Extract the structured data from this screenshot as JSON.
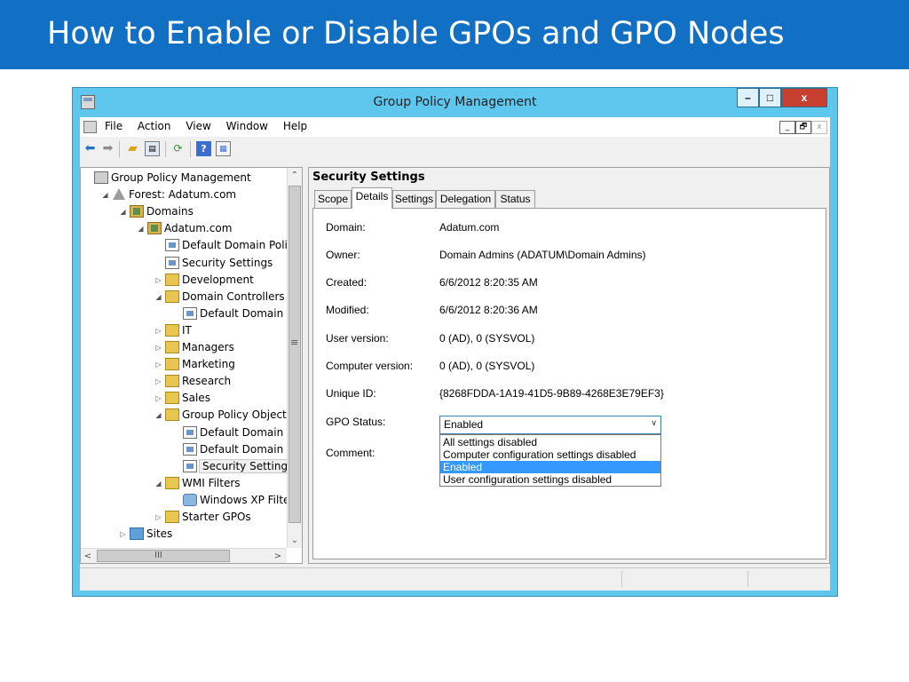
{
  "slide": {
    "title": "How to Enable or Disable GPOs and GPO Nodes"
  },
  "window": {
    "title": "Group Policy Management",
    "controls": {
      "minimize": "–",
      "maximize": "□",
      "close": "x"
    }
  },
  "menu": {
    "items": [
      "File",
      "Action",
      "View",
      "Window",
      "Help"
    ],
    "mdi_controls": {
      "minimize": "_",
      "restore": "🗗",
      "close": "x"
    }
  },
  "toolbar": {
    "icons": [
      "back-arrow-icon",
      "forward-arrow-icon",
      "folder-up-icon",
      "show-hide-tree-icon",
      "refresh-icon",
      "help-icon",
      "properties-icon"
    ]
  },
  "tree": {
    "items": [
      {
        "label": "Group Policy Management",
        "icon": "console-icon",
        "level": 0,
        "expander": ""
      },
      {
        "label": "Forest: Adatum.com",
        "icon": "forest-icon",
        "level": 1,
        "expander": "◢"
      },
      {
        "label": "Domains",
        "icon": "domains-icon",
        "level": 2,
        "expander": "◢"
      },
      {
        "label": "Adatum.com",
        "icon": "domain-icon",
        "level": 3,
        "expander": "◢"
      },
      {
        "label": "Default Domain Policy",
        "icon": "gpo-link-icon",
        "level": 4,
        "expander": ""
      },
      {
        "label": "Security Settings",
        "icon": "gpo-link-icon",
        "level": 4,
        "expander": ""
      },
      {
        "label": "Development",
        "icon": "ou-icon",
        "level": 4,
        "expander": "▷"
      },
      {
        "label": "Domain Controllers",
        "icon": "ou-icon",
        "level": 4,
        "expander": "◢"
      },
      {
        "label": "Default Domain Cc",
        "icon": "gpo-link-icon",
        "level": 5,
        "expander": ""
      },
      {
        "label": "IT",
        "icon": "ou-icon",
        "level": 4,
        "expander": "▷"
      },
      {
        "label": "Managers",
        "icon": "ou-icon",
        "level": 4,
        "expander": "▷"
      },
      {
        "label": "Marketing",
        "icon": "ou-icon",
        "level": 4,
        "expander": "▷"
      },
      {
        "label": "Research",
        "icon": "ou-icon",
        "level": 4,
        "expander": "▷"
      },
      {
        "label": "Sales",
        "icon": "ou-icon",
        "level": 4,
        "expander": "▷"
      },
      {
        "label": "Group Policy Objects",
        "icon": "gpo-container-icon",
        "level": 4,
        "expander": "◢"
      },
      {
        "label": "Default Domain Cc",
        "icon": "gpo-icon",
        "level": 5,
        "expander": ""
      },
      {
        "label": "Default Domain Pc",
        "icon": "gpo-icon",
        "level": 5,
        "expander": ""
      },
      {
        "label": "Security Settings",
        "icon": "gpo-icon",
        "level": 5,
        "expander": "",
        "selected": true
      },
      {
        "label": "WMI Filters",
        "icon": "wmi-container-icon",
        "level": 4,
        "expander": "◢"
      },
      {
        "label": "Windows XP Filter",
        "icon": "wmi-filter-icon",
        "level": 5,
        "expander": ""
      },
      {
        "label": "Starter GPOs",
        "icon": "starter-gpo-icon",
        "level": 4,
        "expander": "▷"
      },
      {
        "label": "Sites",
        "icon": "sites-icon",
        "level": 2,
        "expander": "▷"
      }
    ],
    "scrollbar": {
      "up": "⌃",
      "down": "⌄",
      "left": "<",
      "right": ">",
      "grip": "≡",
      "hgrip": "III"
    }
  },
  "details": {
    "title": "Security Settings",
    "tabs": [
      {
        "label": "Scope",
        "active": false
      },
      {
        "label": "Details",
        "active": true
      },
      {
        "label": "Settings",
        "active": false
      },
      {
        "label": "Delegation",
        "active": false
      },
      {
        "label": "Status",
        "active": false
      }
    ],
    "fields": [
      {
        "label": "Domain:",
        "value": "Adatum.com"
      },
      {
        "label": "Owner:",
        "value": "Domain Admins (ADATUM\\Domain Admins)"
      },
      {
        "label": "Created:",
        "value": "6/6/2012 8:20:35 AM"
      },
      {
        "label": "Modified:",
        "value": "6/6/2012 8:20:36 AM"
      },
      {
        "label": "User version:",
        "value": "0 (AD), 0 (SYSVOL)"
      },
      {
        "label": "Computer version:",
        "value": "0 (AD), 0 (SYSVOL)"
      },
      {
        "label": "Unique ID:",
        "value": "{8268FDDA-1A19-41D5-9B89-4268E3E79EF3}"
      }
    ],
    "gpo_status": {
      "label": "GPO Status:",
      "value": "Enabled",
      "options": [
        {
          "label": "All settings disabled",
          "selected": false
        },
        {
          "label": "Computer configuration settings disabled",
          "selected": false
        },
        {
          "label": "Enabled",
          "selected": true
        },
        {
          "label": "User configuration settings disabled",
          "selected": false
        }
      ]
    },
    "comment": {
      "label": "Comment:"
    }
  },
  "colors": {
    "slide_header": "#1170c4",
    "window_frame": "#5fc7ee",
    "close_button": "#c7402f",
    "selection": "#3399ff"
  }
}
